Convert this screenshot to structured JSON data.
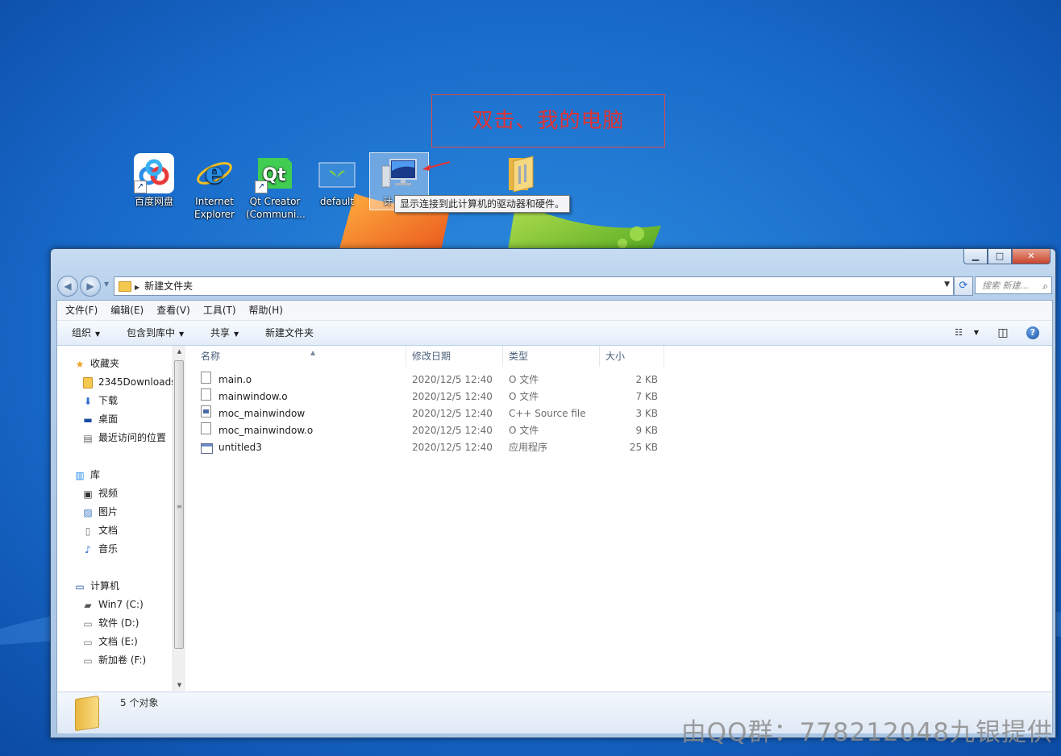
{
  "desktop": {
    "icons": [
      {
        "label": "百度网盘"
      },
      {
        "label_line1": "Internet",
        "label_line2": "Explorer"
      },
      {
        "label_line1": "Qt Creator",
        "label_line2": "(Communi..."
      },
      {
        "label": "default"
      },
      {
        "label": "计"
      },
      {
        "label": ""
      }
    ],
    "annotation": "双击、我的电脑",
    "tooltip": "显示连接到此计算机的驱动器和硬件。",
    "watermark": "由QQ群：778212048九银提供"
  },
  "window": {
    "caption": {
      "minimize": "▁",
      "maximize": "□",
      "close": "✕"
    },
    "address": {
      "path": "新建文件夹"
    },
    "search": {
      "placeholder": "搜索 新建..."
    },
    "menu": [
      "文件(F)",
      "编辑(E)",
      "查看(V)",
      "工具(T)",
      "帮助(H)"
    ],
    "toolbar": {
      "organize": "组织",
      "include_library": "包含到库中",
      "share": "共享",
      "new_folder": "新建文件夹"
    },
    "nav": {
      "favorites": "收藏夹",
      "favorites_items": [
        "2345Downloads",
        "下载",
        "桌面",
        "最近访问的位置"
      ],
      "libraries": "库",
      "library_items": [
        "视频",
        "图片",
        "文档",
        "音乐"
      ],
      "computer": "计算机",
      "computer_items": [
        "Win7 (C:)",
        "软件 (D:)",
        "文档 (E:)",
        "新加卷 (F:)"
      ]
    },
    "columns": {
      "name": "名称",
      "date": "修改日期",
      "type": "类型",
      "size": "大小"
    },
    "files": [
      {
        "name": "main.o",
        "date": "2020/12/5 12:40",
        "type": "O 文件",
        "size": "2 KB",
        "icon": "file-icon"
      },
      {
        "name": "mainwindow.o",
        "date": "2020/12/5 12:40",
        "type": "O 文件",
        "size": "7 KB",
        "icon": "file-icon"
      },
      {
        "name": "moc_mainwindow",
        "date": "2020/12/5 12:40",
        "type": "C++ Source file",
        "size": "3 KB",
        "icon": "cpp-file-icon"
      },
      {
        "name": "moc_mainwindow.o",
        "date": "2020/12/5 12:40",
        "type": "O 文件",
        "size": "9 KB",
        "icon": "file-icon"
      },
      {
        "name": "untitled3",
        "date": "2020/12/5 12:40",
        "type": "应用程序",
        "size": "25 KB",
        "icon": "exe-icon"
      }
    ],
    "status": "5 个对象"
  },
  "colors": {
    "annotation": "#e03434",
    "desktop_blue": "#1565c8"
  }
}
